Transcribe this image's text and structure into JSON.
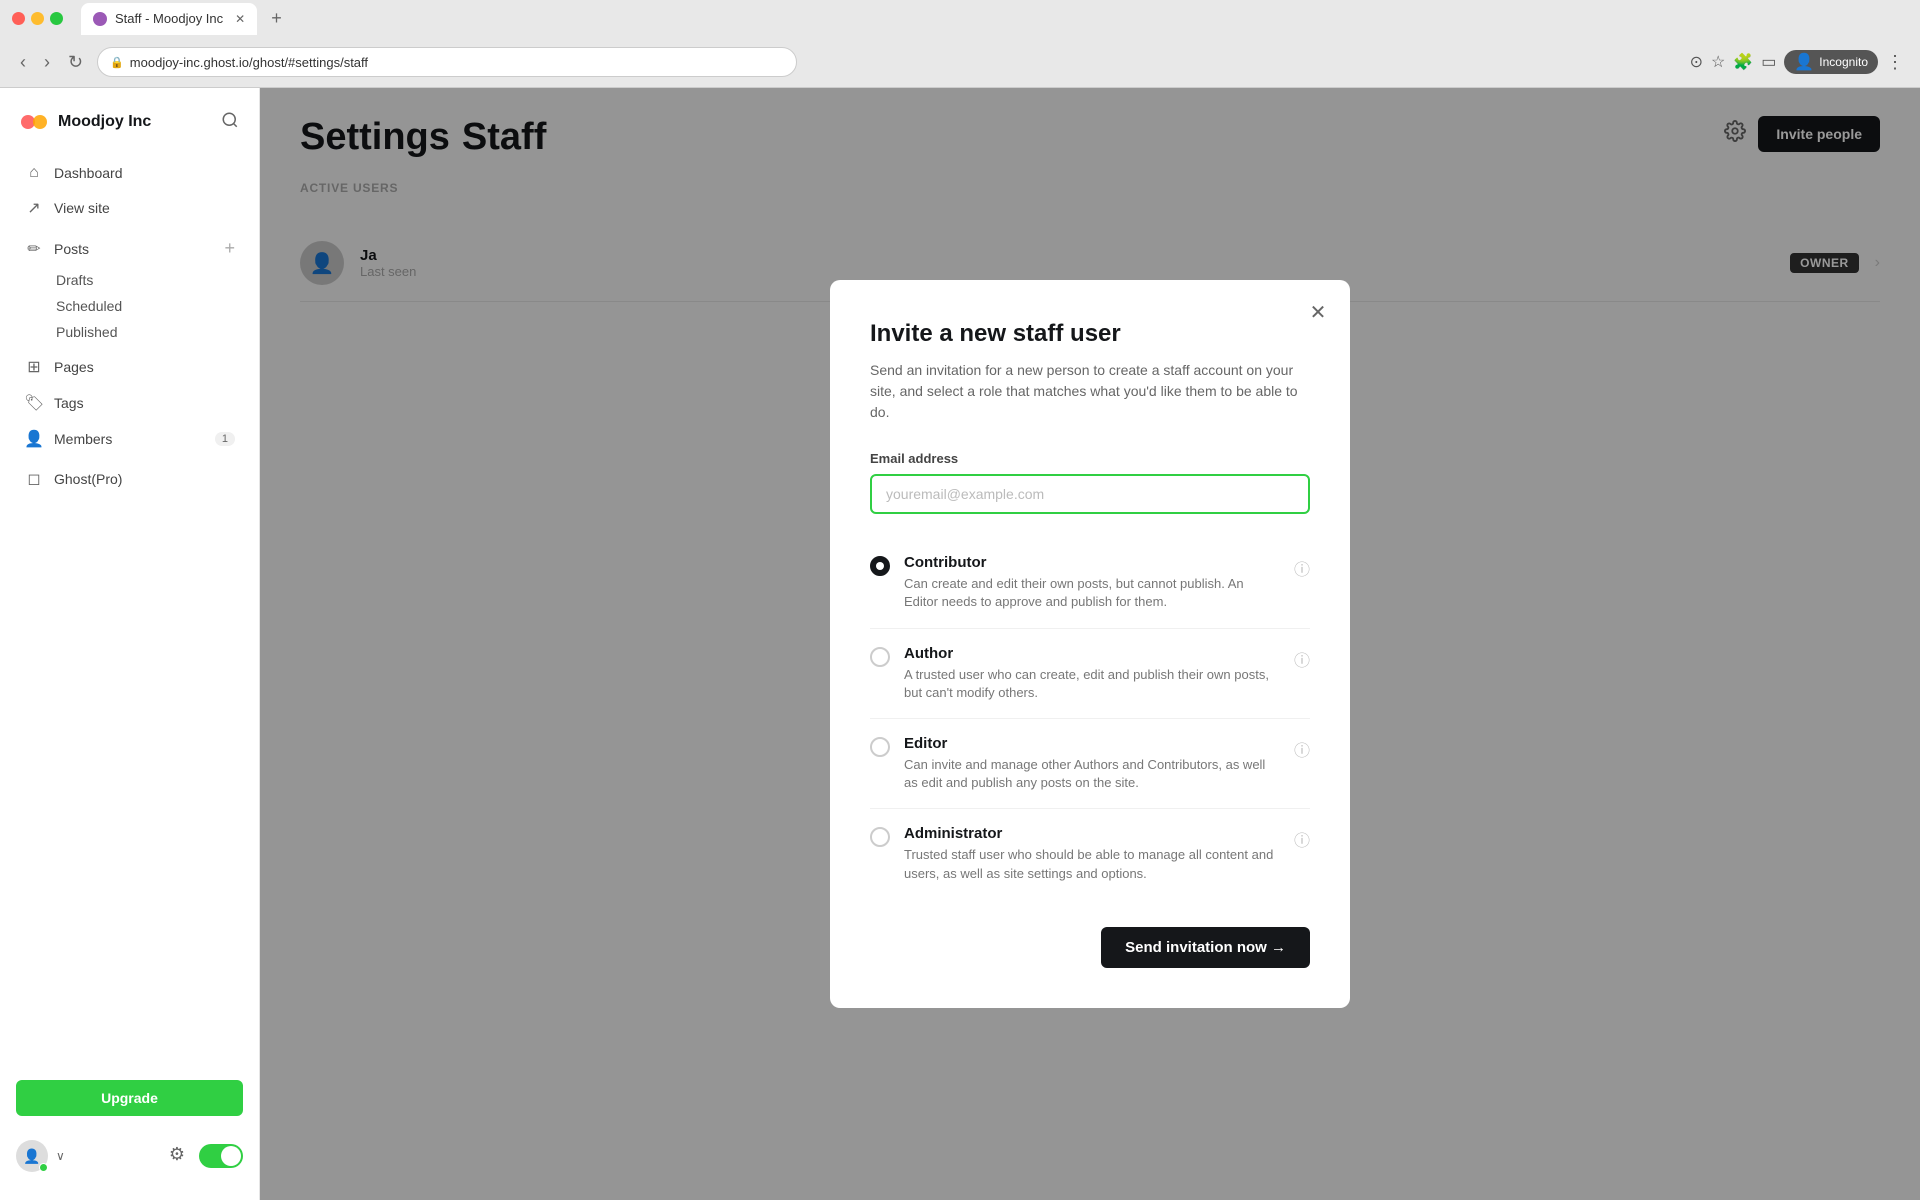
{
  "browser": {
    "tab_title": "Staff - Moodjoy Inc",
    "address": "moodjoy-inc.ghost.io/ghost/#settings/staff",
    "incognito_label": "Incognito",
    "new_tab_symbol": "+"
  },
  "sidebar": {
    "brand_name": "Moodjoy Inc",
    "search_placeholder": "Search",
    "nav": {
      "dashboard": "Dashboard",
      "view_site": "View site",
      "posts": "Posts",
      "drafts": "Drafts",
      "scheduled": "Scheduled",
      "published": "Published",
      "pages": "Pages",
      "tags": "Tags",
      "members": "Members",
      "members_count": "1",
      "ghost_pro": "Ghost(Pro)"
    },
    "upgrade_label": "Upgrade",
    "footer": {
      "settings_label": "Settings",
      "toggle_label": "Toggle theme"
    }
  },
  "main": {
    "page_title_settings": "Settings",
    "page_title_staff": "Staff",
    "section_label": "ACTIVE USERS",
    "staff_member": {
      "name_partial": "Ja",
      "meta": "Last seen",
      "role": "OWNER"
    },
    "invite_people_label": "Invite people"
  },
  "modal": {
    "title": "Invite a new staff user",
    "subtitle": "Send an invitation for a new person to create a staff account on your site, and select a role that matches what you'd like them to be able to do.",
    "email_label": "Email address",
    "email_placeholder": "youremail@example.com",
    "roles": [
      {
        "id": "contributor",
        "name": "Contributor",
        "description": "Can create and edit their own posts, but cannot publish. An Editor needs to approve and publish for them.",
        "selected": true
      },
      {
        "id": "author",
        "name": "Author",
        "description": "A trusted user who can create, edit and publish their own posts, but can't modify others.",
        "selected": false
      },
      {
        "id": "editor",
        "name": "Editor",
        "description": "Can invite and manage other Authors and Contributors, as well as edit and publish any posts on the site.",
        "selected": false
      },
      {
        "id": "administrator",
        "name": "Administrator",
        "description": "Trusted staff user who should be able to manage all content and users, as well as site settings and options.",
        "selected": false
      }
    ],
    "send_button": "Send invitation now →",
    "close_symbol": "✕"
  }
}
